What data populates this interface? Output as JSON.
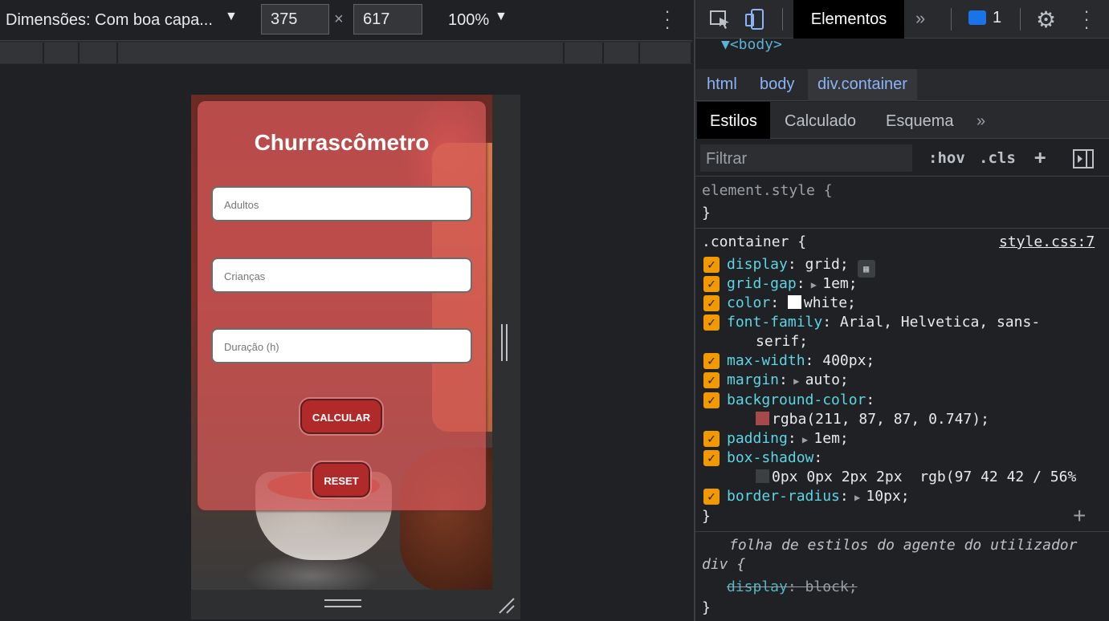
{
  "device_toolbar": {
    "dimensions_label": "Dimensões: Com boa capa...",
    "width": "375",
    "times": "×",
    "height": "617",
    "zoom": "100%"
  },
  "page": {
    "title": "Churrascômetro",
    "inputs": [
      {
        "placeholder": "Adultos"
      },
      {
        "placeholder": "Crianças"
      },
      {
        "placeholder": "Duração (h)"
      }
    ],
    "calculate_label": "CALCULAR",
    "reset_label": "RESET"
  },
  "devtools": {
    "active_tab": "Elementos",
    "message_count": "1",
    "dom_body_tag": "▼<body>",
    "breadcrumbs": [
      "html",
      "body",
      "div.container"
    ],
    "subtabs": [
      "Estilos",
      "Calculado",
      "Esquema"
    ],
    "filter_placeholder": "Filtrar",
    "hov": ":hov",
    "cls": ".cls",
    "styles": {
      "element_style_selector": "element.style {",
      "close_brace": "}",
      "container_selector": ".container {",
      "source": "style.css:7",
      "props": [
        {
          "name": "display",
          "value": "grid;"
        },
        {
          "name": "grid-gap",
          "value": "1em;"
        },
        {
          "name": "color",
          "value": "white;"
        },
        {
          "name": "font-family",
          "value": "Arial, Helvetica, sans-"
        },
        {
          "name": "",
          "value": "serif;"
        },
        {
          "name": "max-width",
          "value": "400px;"
        },
        {
          "name": "margin",
          "value": "auto;"
        },
        {
          "name": "background-color",
          "value": ""
        },
        {
          "name": "",
          "value": "rgba(211, 87, 87, 0.747);"
        },
        {
          "name": "padding",
          "value": "1em;"
        },
        {
          "name": "box-shadow",
          "value": ""
        },
        {
          "name": "",
          "value": "0px 0px 2px 2px  rgb(97 42 42 / 56%"
        },
        {
          "name": "border-radius",
          "value": "10px;"
        }
      ],
      "ua_comment": "folha de estilos do agente do utilizador",
      "ua_selector": "div {",
      "ua_prop": "display",
      "ua_value": "block;"
    }
  },
  "colors": {
    "container_bg": "#d35757",
    "button_bg": "#b12a2a",
    "checkbox": "#f29900",
    "property": "#5cd5e4",
    "link": "#8ab4f8"
  }
}
